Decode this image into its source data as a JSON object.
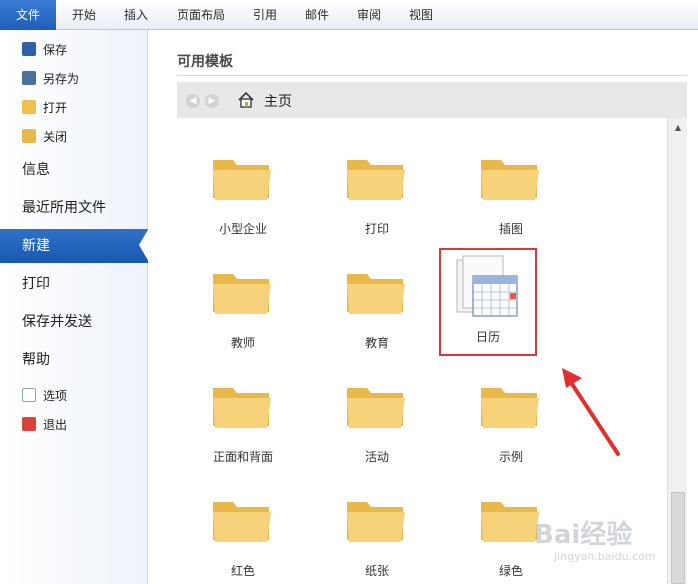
{
  "ribbon": {
    "tabs": [
      {
        "label": "文件",
        "active": true
      },
      {
        "label": "开始"
      },
      {
        "label": "插入"
      },
      {
        "label": "页面布局"
      },
      {
        "label": "引用"
      },
      {
        "label": "邮件"
      },
      {
        "label": "审阅"
      },
      {
        "label": "视图"
      }
    ]
  },
  "sidebar": {
    "small_items": [
      {
        "label": "保存",
        "icon": "save-icon"
      },
      {
        "label": "另存为",
        "icon": "save-as-icon"
      },
      {
        "label": "打开",
        "icon": "open-folder-icon"
      },
      {
        "label": "关闭",
        "icon": "close-folder-icon"
      }
    ],
    "big_items": [
      {
        "label": "信息"
      },
      {
        "label": "最近所用文件"
      },
      {
        "label": "新建",
        "active": true
      },
      {
        "label": "打印"
      },
      {
        "label": "保存并发送"
      },
      {
        "label": "帮助"
      }
    ],
    "bottom_items": [
      {
        "label": "选项",
        "icon": "options-icon"
      },
      {
        "label": "退出",
        "icon": "exit-icon"
      }
    ]
  },
  "main": {
    "heading": "可用模板",
    "nav": {
      "label": "主页",
      "icon": "home-icon"
    },
    "templates": [
      {
        "label": "小型企业",
        "icon": "folder-icon"
      },
      {
        "label": "打印",
        "icon": "folder-icon"
      },
      {
        "label": "插图",
        "icon": "folder-icon"
      },
      {
        "label": "教师",
        "icon": "folder-icon"
      },
      {
        "label": "教育",
        "icon": "folder-icon"
      },
      {
        "label": "日历",
        "icon": "calendar-icon",
        "selected": true
      },
      {
        "label": "正面和背面",
        "icon": "folder-icon"
      },
      {
        "label": "活动",
        "icon": "folder-icon"
      },
      {
        "label": "示例",
        "icon": "folder-icon"
      },
      {
        "label": "红色",
        "icon": "folder-icon"
      },
      {
        "label": "纸张",
        "icon": "folder-icon"
      },
      {
        "label": "绿色",
        "icon": "folder-icon"
      }
    ]
  },
  "watermark": {
    "brand": "Bai经验",
    "url": "jingyan.baidu.com"
  },
  "colors": {
    "accent": "#1f5fb8",
    "highlight": "#d83a3a",
    "folder": "#f2c75a"
  }
}
